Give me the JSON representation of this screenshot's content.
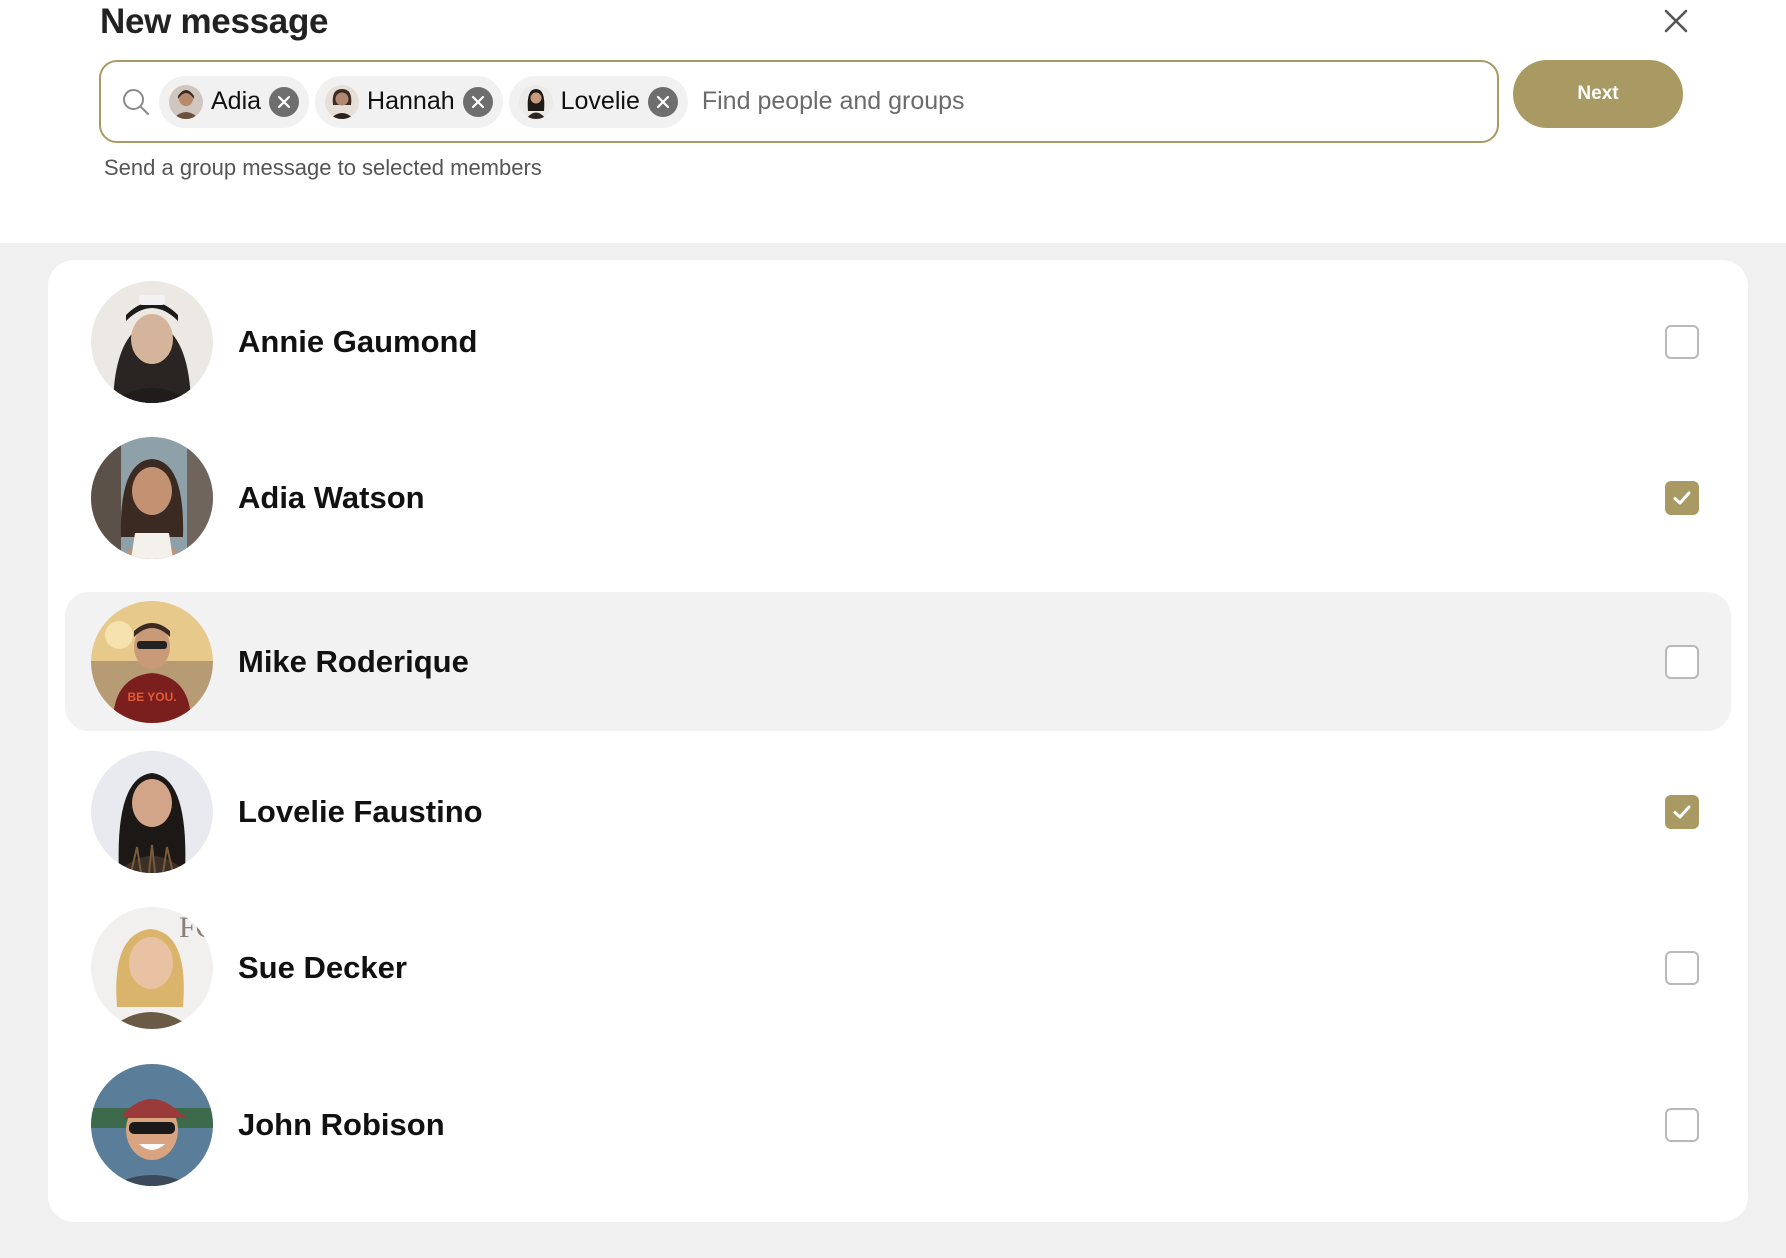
{
  "header": {
    "title": "New message",
    "close_icon": "close-icon"
  },
  "search": {
    "placeholder": "Find people and groups",
    "value": "",
    "icon": "search-icon",
    "chips": [
      {
        "label": "Adia",
        "avatar_colors": [
          "#6b4e3d",
          "#d9c2a8"
        ]
      },
      {
        "label": "Hannah",
        "avatar_colors": [
          "#3d2b24",
          "#b08970"
        ]
      },
      {
        "label": "Lovelie",
        "avatar_colors": [
          "#1e1a18",
          "#e8e3dc"
        ]
      }
    ]
  },
  "next_button": {
    "label": "Next"
  },
  "helper_text": "Send a group message to selected members",
  "colors": {
    "accent": "#a99a64",
    "row_highlight": "#f2f2f2",
    "page_bg": "#f0f0f0"
  },
  "members": [
    {
      "name": "Annie Gaumond",
      "checked": false,
      "avatar_colors": [
        "#2a2522",
        "#d4b59b",
        "#ece8e4"
      ]
    },
    {
      "name": "Adia Watson",
      "checked": true,
      "avatar_colors": [
        "#3b2a22",
        "#c39273",
        "#8ea0a8"
      ]
    },
    {
      "name": "Mike Roderique",
      "checked": false,
      "avatar_colors": [
        "#7a1e1e",
        "#c99a78",
        "#e7c98c"
      ]
    },
    {
      "name": "Lovelie Faustino",
      "checked": true,
      "avatar_colors": [
        "#1c1816",
        "#d2a588",
        "#e9eaf0"
      ]
    },
    {
      "name": "Sue Decker",
      "checked": false,
      "avatar_colors": [
        "#d9b46a",
        "#e8c2a2",
        "#f2f0ee"
      ]
    },
    {
      "name": "John Robison",
      "checked": false,
      "avatar_colors": [
        "#9b3a3a",
        "#d8a481",
        "#5a7d99"
      ]
    }
  ]
}
